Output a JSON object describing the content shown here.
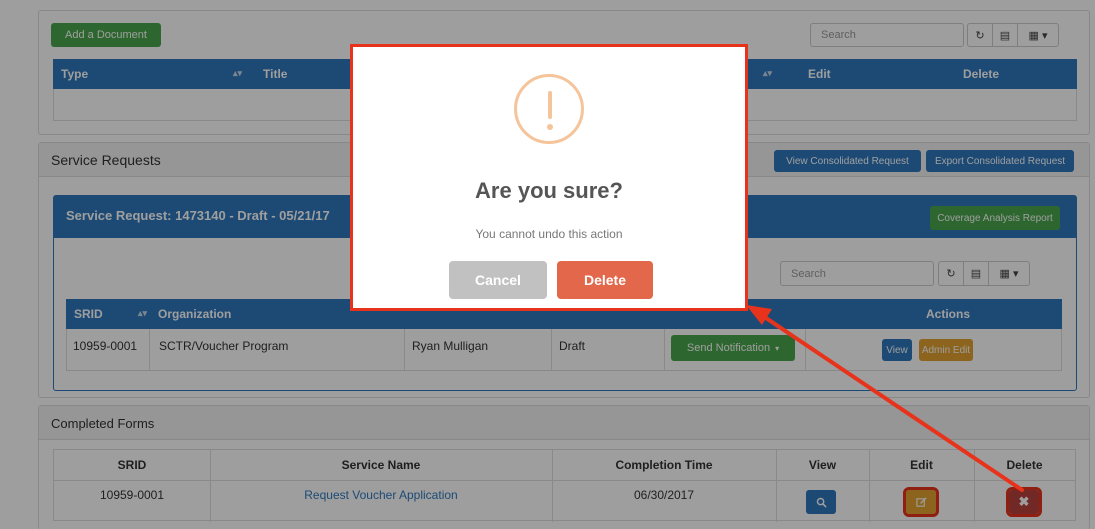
{
  "documents": {
    "add_button": "Add a Document",
    "search_placeholder": "Search",
    "columns": {
      "type": "Type",
      "title": "Title",
      "edit": "Edit",
      "delete": "Delete"
    }
  },
  "service_requests": {
    "title": "Service Requests",
    "view_consolidated": "View Consolidated Request",
    "export_consolidated": "Export Consolidated Request",
    "request_title": "Service Request: 1473140 - Draft - 05/21/17",
    "coverage_button": "Coverage Analysis Report",
    "search_placeholder": "Search",
    "columns": {
      "srid": "SRID",
      "organization": "Organization",
      "actions": "Actions"
    },
    "row": {
      "srid": "10959-0001",
      "organization": "SCTR/Voucher Program",
      "owner": "Ryan Mulligan",
      "status": "Draft",
      "notification_button": "Send Notification",
      "view_button": "View",
      "admin_edit_button": "Admin Edit"
    }
  },
  "completed_forms": {
    "title": "Completed Forms",
    "columns": [
      "SRID",
      "Service Name",
      "Completion Time",
      "View",
      "Edit",
      "Delete"
    ],
    "row": {
      "srid": "10959-0001",
      "service_name": "Request Voucher Application",
      "completion_time": "06/30/2017"
    }
  },
  "modal": {
    "title": "Are you sure?",
    "text": "You cannot undo this action",
    "cancel": "Cancel",
    "delete": "Delete"
  },
  "colors": {
    "primary": "#2f78bd",
    "success": "#4aa64d",
    "warning": "#e3a231",
    "danger": "#b9433c",
    "modal_delete": "#e3674a",
    "modal_cancel": "#c1c1c1",
    "highlight": "#e8331c"
  },
  "icons": [
    "warning-icon",
    "refresh-icon",
    "columns-icon",
    "grid-icon",
    "search-icon",
    "edit-icon",
    "close-icon",
    "sort-icon",
    "caret-down-icon"
  ]
}
